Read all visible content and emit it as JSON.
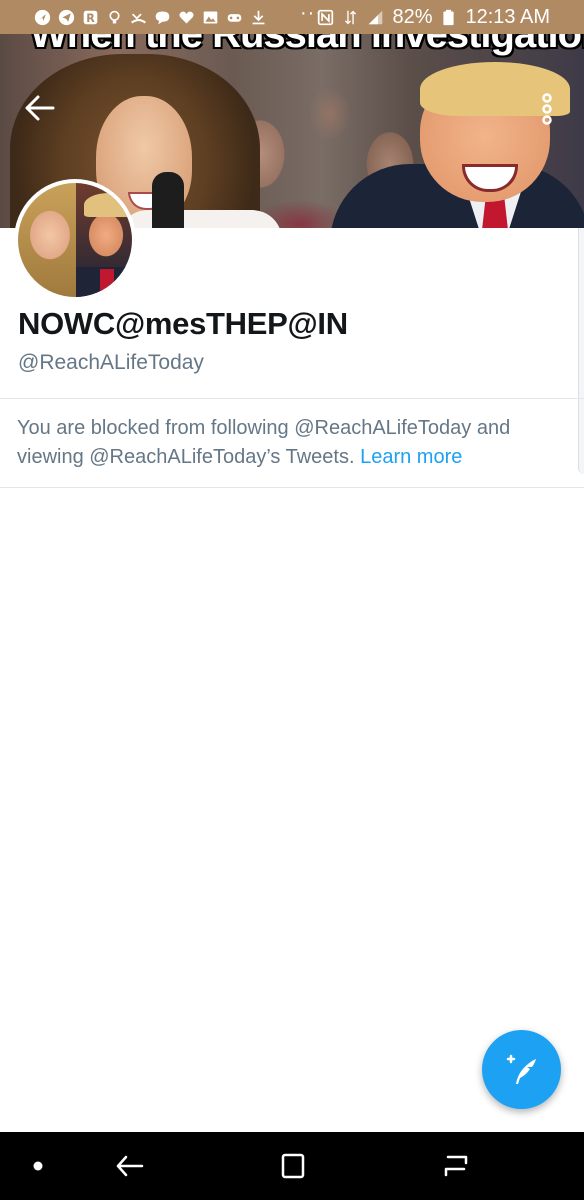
{
  "status_bar": {
    "dots": "···",
    "battery_percent": "82%",
    "time": "12:13 AM",
    "icons": [
      "navigation-icon",
      "telegram-icon",
      "r-app-icon",
      "lightbulb-icon",
      "missed-call-icon",
      "chat-bubble-icon",
      "heart-icon",
      "image-icon",
      "game-icon",
      "download-icon",
      "nfc-icon",
      "data-arrows-icon",
      "signal-icon",
      "battery-icon"
    ]
  },
  "banner": {
    "caption": "When the Russian investigation..."
  },
  "profile": {
    "display_name": "NOWC@mesTHEP@IN",
    "handle": "@ReachALifeToday",
    "blocked_text": "You are blocked from following @ReachALifeToday and viewing @ReachALifeToday’s Tweets.",
    "learn_more": "Learn more"
  },
  "colors": {
    "status_bar": "#b08a62",
    "accent": "#1da1f2",
    "secondary_text": "#657786",
    "primary_text": "#14171a"
  }
}
